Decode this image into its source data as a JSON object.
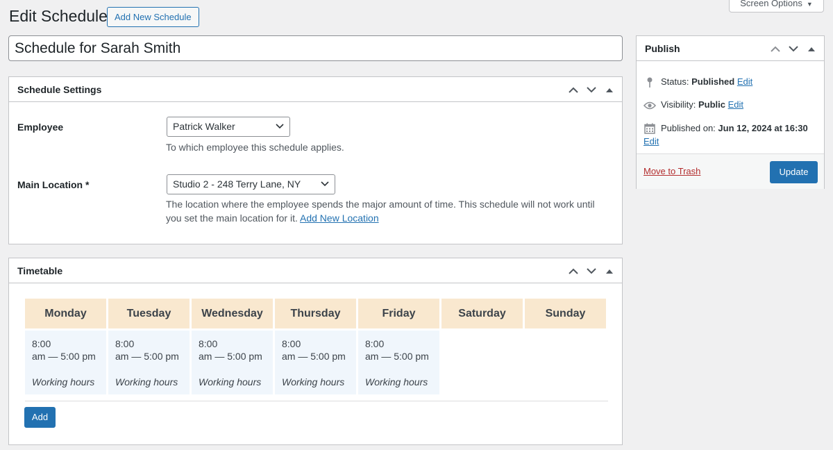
{
  "header": {
    "title": "Edit Schedule",
    "add_new_label": "Add New Schedule",
    "screen_options_label": "Screen Options"
  },
  "post_title": {
    "value": "Schedule for Sarah Smith"
  },
  "settings": {
    "title": "Schedule Settings",
    "employee": {
      "label": "Employee",
      "selected": "Patrick Walker",
      "description": "To which employee this schedule applies."
    },
    "location": {
      "label": "Main Location *",
      "selected": "Studio 2 - 248 Terry Lane, NY",
      "description_line1": "The location where the employee spends the major amount of time. This schedule will not work until",
      "description_line2": "you set the main location for it.",
      "link_label": "Add New Location"
    }
  },
  "timetable": {
    "title": "Timetable",
    "days": [
      {
        "name": "Monday",
        "start": "8:00",
        "end": "am — 5:00 pm",
        "label": "Working hours"
      },
      {
        "name": "Tuesday",
        "start": "8:00",
        "end": "am — 5:00 pm",
        "label": "Working hours"
      },
      {
        "name": "Wednesday",
        "start": "8:00",
        "end": "am — 5:00 pm",
        "label": "Working hours"
      },
      {
        "name": "Thursday",
        "start": "8:00",
        "end": "am — 5:00 pm",
        "label": "Working hours"
      },
      {
        "name": "Friday",
        "start": "8:00",
        "end": "am — 5:00 pm",
        "label": "Working hours"
      },
      {
        "name": "Saturday"
      },
      {
        "name": "Sunday"
      }
    ],
    "add_label": "Add"
  },
  "publish": {
    "title": "Publish",
    "status_label": "Status:",
    "status_value": "Published",
    "visibility_label": "Visibility:",
    "visibility_value": "Public",
    "published_label": "Published on:",
    "published_value": "Jun 12, 2024 at 16:30",
    "edit_label": "Edit",
    "trash_label": "Move to Trash",
    "update_label": "Update"
  },
  "icons": {
    "status": "pin-icon",
    "visibility": "eye-icon",
    "date": "calendar-icon"
  },
  "colors": {
    "accent": "#2271b1",
    "day_header_bg": "#f9e8cf",
    "hours_cell_bg": "#f0f6fc",
    "trash": "#b32d2e"
  }
}
